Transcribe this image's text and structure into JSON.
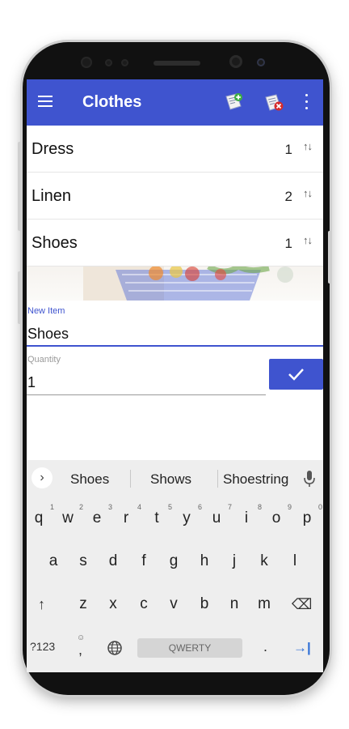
{
  "appbar": {
    "title": "Clothes",
    "menu_icon": "hamburger-menu-icon",
    "actions": [
      "add-list-icon",
      "delete-list-icon",
      "more-vert-icon"
    ],
    "color": "#3f54cf"
  },
  "items": [
    {
      "name": "Dress",
      "qty": "1",
      "sort_icon": "↑↓"
    },
    {
      "name": "Linen",
      "qty": "2",
      "sort_icon": "↑↓"
    },
    {
      "name": "Shoes",
      "qty": "1",
      "sort_icon": "↑↓"
    }
  ],
  "form": {
    "new_item_label": "New Item",
    "new_item_value": "Shoes",
    "quantity_label": "Quantity",
    "quantity_value": "1",
    "confirm_icon": "check-icon"
  },
  "keyboard": {
    "suggestions": [
      "Shoes",
      "Shows",
      "Shoestring"
    ],
    "row1": [
      "q",
      "w",
      "e",
      "r",
      "t",
      "y",
      "u",
      "i",
      "o",
      "p"
    ],
    "row1_hints": [
      "1",
      "2",
      "3",
      "4",
      "5",
      "6",
      "7",
      "8",
      "9",
      "0"
    ],
    "row2": [
      "a",
      "s",
      "d",
      "f",
      "g",
      "h",
      "j",
      "k",
      "l"
    ],
    "row3": [
      "z",
      "x",
      "c",
      "v",
      "b",
      "n",
      "m"
    ],
    "symbols_label": "?123",
    "comma_label": ",",
    "comma_hint": "☺",
    "space_label": "QWERTY",
    "period_label": ".",
    "shift_icon": "↑",
    "backspace_icon": "⌫",
    "enter_icon": "→|"
  }
}
